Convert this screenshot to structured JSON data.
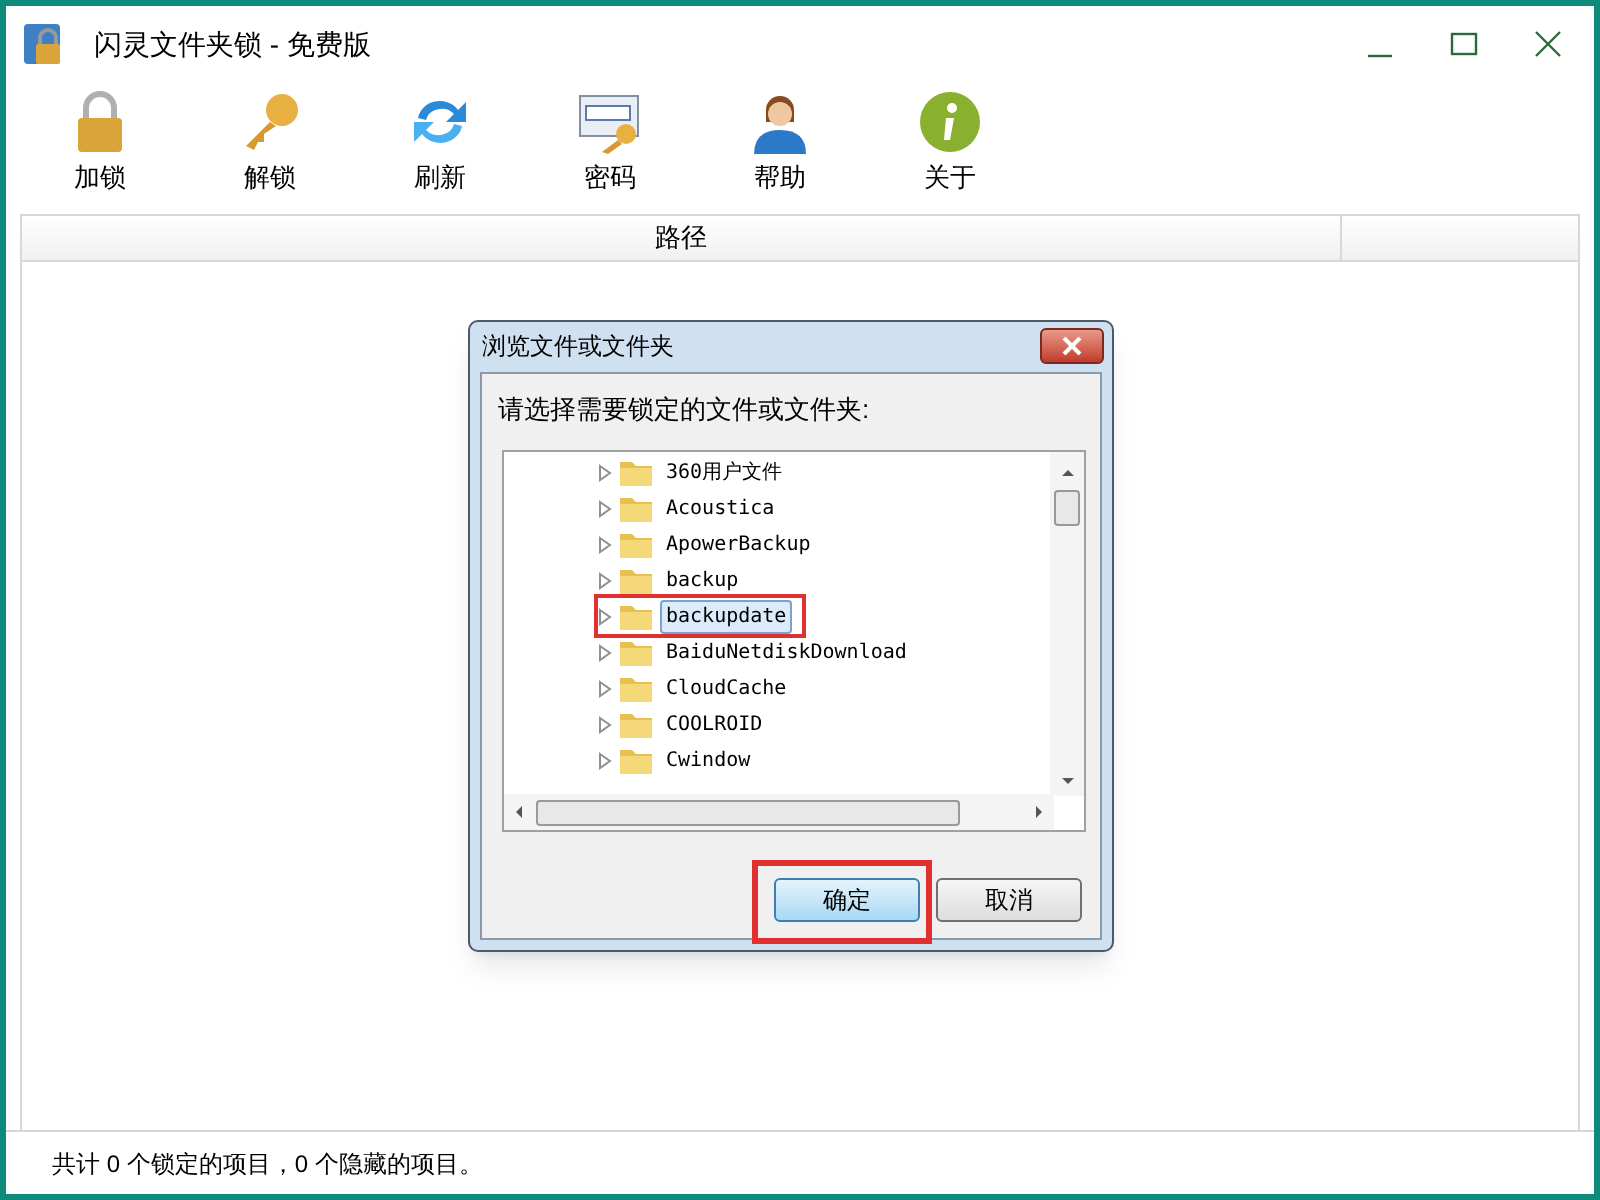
{
  "window": {
    "title": "闪灵文件夹锁 - 免费版"
  },
  "toolbar": [
    {
      "label": "加锁",
      "kind": "lock"
    },
    {
      "label": "解锁",
      "kind": "key"
    },
    {
      "label": "刷新",
      "kind": "refresh"
    },
    {
      "label": "密码",
      "kind": "password"
    },
    {
      "label": "帮助",
      "kind": "help"
    },
    {
      "label": "关于",
      "kind": "info"
    }
  ],
  "table": {
    "columns": [
      "路径"
    ]
  },
  "dialog": {
    "title": "浏览文件或文件夹",
    "prompt": "请选择需要锁定的文件或文件夹:",
    "tree": [
      {
        "label": "360用户文件",
        "selected": false
      },
      {
        "label": "Acoustica",
        "selected": false
      },
      {
        "label": "ApowerBackup",
        "selected": false
      },
      {
        "label": "backup",
        "selected": false
      },
      {
        "label": "backupdate",
        "selected": true
      },
      {
        "label": "BaiduNetdiskDownload",
        "selected": false
      },
      {
        "label": "CloudCache",
        "selected": false
      },
      {
        "label": "COOLROID",
        "selected": false
      },
      {
        "label": "Cwindow",
        "selected": false
      }
    ],
    "buttons": [
      {
        "label": "确定",
        "kind": "default"
      },
      {
        "label": "取消",
        "kind": "normal"
      }
    ]
  },
  "status_bar": "共计 0 个锁定的项目，0 个隐藏的项目。"
}
